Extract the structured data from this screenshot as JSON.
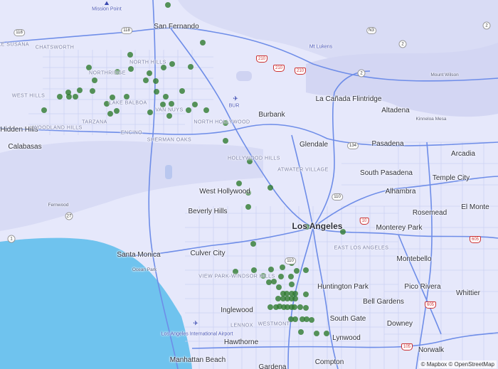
{
  "attribution": "© Mapbox © OpenStreetMap",
  "colors": {
    "land": "#e6e8fb",
    "water": "#6fc3ee",
    "park": "#d8dcf6",
    "road_major": "#6e8de8",
    "road_minor": "#c9cef2",
    "point": "#2f7a2f"
  },
  "labels": {
    "cities": [
      {
        "id": "mission-point",
        "text": "Mission Point",
        "cls": "poi"
      },
      {
        "id": "san-fernando",
        "text": "San Fernando",
        "cls": "city"
      },
      {
        "id": "mt-lukens",
        "text": "Mt Lukens",
        "cls": "poi"
      },
      {
        "id": "lake-susana",
        "text": "Lake Susana",
        "cls": "hood"
      },
      {
        "id": "chatsworth",
        "text": "CHATSWORTH",
        "cls": "hood"
      },
      {
        "id": "northridge",
        "text": "NORTHRIDGE",
        "cls": "hood"
      },
      {
        "id": "west-hills",
        "text": "WEST HILLS",
        "cls": "hood"
      },
      {
        "id": "lake-balboa",
        "text": "LAKE BALBOA",
        "cls": "hood"
      },
      {
        "id": "van-nuys",
        "text": "VAN NUYS",
        "cls": "hood"
      },
      {
        "id": "north-hills",
        "text": "NORTH HILLS",
        "cls": "hood"
      },
      {
        "id": "north-hollywood",
        "text": "NORTH HOLLYWOOD",
        "cls": "hood"
      },
      {
        "id": "bur",
        "text": "BUR",
        "cls": "poi"
      },
      {
        "id": "burbank",
        "text": "Burbank",
        "cls": "city"
      },
      {
        "id": "la-canada",
        "text": "La Cañada Flintridge",
        "cls": "city"
      },
      {
        "id": "altadena",
        "text": "Altadena",
        "cls": "city"
      },
      {
        "id": "kinneloa-mesa",
        "text": "Kinneloa Mesa",
        "cls": "peak"
      },
      {
        "id": "mount-wilson",
        "text": "Mount Wilson",
        "cls": "peak"
      },
      {
        "id": "hidden-hills",
        "text": "Hidden Hills",
        "cls": "city"
      },
      {
        "id": "woodland-hills",
        "text": "WOODLAND HILLS",
        "cls": "hood"
      },
      {
        "id": "tarzana",
        "text": "TARZANA",
        "cls": "hood"
      },
      {
        "id": "encino",
        "text": "ENCINO",
        "cls": "hood"
      },
      {
        "id": "sherman-oaks",
        "text": "SHERMAN OAKS",
        "cls": "hood"
      },
      {
        "id": "calabasas",
        "text": "Calabasas",
        "cls": "city"
      },
      {
        "id": "glendale",
        "text": "Glendale",
        "cls": "city"
      },
      {
        "id": "pasadena",
        "text": "Pasadena",
        "cls": "city"
      },
      {
        "id": "arcadia",
        "text": "Arcadia",
        "cls": "city"
      },
      {
        "id": "hollywood-hills",
        "text": "HOLLYWOOD HILLS",
        "cls": "hood"
      },
      {
        "id": "atwater-village",
        "text": "ATWATER VILLAGE",
        "cls": "hood"
      },
      {
        "id": "south-pasadena",
        "text": "South Pasadena",
        "cls": "city"
      },
      {
        "id": "temple-city",
        "text": "Temple City",
        "cls": "city"
      },
      {
        "id": "west-hollywood",
        "text": "West Hollywood",
        "cls": "city"
      },
      {
        "id": "alhambra",
        "text": "Alhambra",
        "cls": "city"
      },
      {
        "id": "fernwood",
        "text": "Fernwood",
        "cls": "peak"
      },
      {
        "id": "beverly-hills",
        "text": "Beverly Hills",
        "cls": "city"
      },
      {
        "id": "rosemead",
        "text": "Rosemead",
        "cls": "city"
      },
      {
        "id": "el-monte",
        "text": "El Monte",
        "cls": "city"
      },
      {
        "id": "los-angeles",
        "text": "Los Angeles",
        "cls": "big"
      },
      {
        "id": "monterey-park",
        "text": "Monterey Park",
        "cls": "city"
      },
      {
        "id": "east-los-angeles",
        "text": "EAST LOS ANGELES",
        "cls": "hood"
      },
      {
        "id": "santa-monica",
        "text": "Santa Monica",
        "cls": "city"
      },
      {
        "id": "culver-city",
        "text": "Culver City",
        "cls": "city"
      },
      {
        "id": "montebello",
        "text": "Montebello",
        "cls": "city"
      },
      {
        "id": "ocean-park",
        "text": "Ocean Park",
        "cls": "peak"
      },
      {
        "id": "view-park",
        "text": "VIEW PARK-WINDSOR HILLS",
        "cls": "hood"
      },
      {
        "id": "huntington-park",
        "text": "Huntington Park",
        "cls": "city"
      },
      {
        "id": "pico-rivera",
        "text": "Pico Rivera",
        "cls": "city"
      },
      {
        "id": "whittier",
        "text": "Whittier",
        "cls": "city"
      },
      {
        "id": "bell-gardens",
        "text": "Bell Gardens",
        "cls": "city"
      },
      {
        "id": "inglewood",
        "text": "Inglewood",
        "cls": "city"
      },
      {
        "id": "south-gate",
        "text": "South Gate",
        "cls": "city"
      },
      {
        "id": "downey",
        "text": "Downey",
        "cls": "city"
      },
      {
        "id": "lax",
        "text": "Los Angeles International Airport",
        "cls": "poi"
      },
      {
        "id": "lennox",
        "text": "LENNOX",
        "cls": "hood"
      },
      {
        "id": "westmont",
        "text": "WESTMONT",
        "cls": "hood"
      },
      {
        "id": "lynwood",
        "text": "Lynwood",
        "cls": "city"
      },
      {
        "id": "hawthorne",
        "text": "Hawthorne",
        "cls": "city"
      },
      {
        "id": "norwalk",
        "text": "Norwalk",
        "cls": "city"
      },
      {
        "id": "manhattan-beach",
        "text": "Manhattan Beach",
        "cls": "city"
      },
      {
        "id": "compton",
        "text": "Compton",
        "cls": "city"
      },
      {
        "id": "gardena",
        "text": "Gardena",
        "cls": "city"
      }
    ],
    "shields": [
      {
        "id": "s118a",
        "text": "118",
        "type": "ca"
      },
      {
        "id": "s118b",
        "text": "118",
        "type": "ca"
      },
      {
        "id": "sn3",
        "text": "N3",
        "type": "ca"
      },
      {
        "id": "s2a",
        "text": "2",
        "type": "circ"
      },
      {
        "id": "s2b",
        "text": "2",
        "type": "circ"
      },
      {
        "id": "s2c",
        "text": "2",
        "type": "circ"
      },
      {
        "id": "s210a",
        "text": "210",
        "type": "interstate"
      },
      {
        "id": "s210b",
        "text": "210",
        "type": "interstate"
      },
      {
        "id": "s210c",
        "text": "210",
        "type": "interstate"
      },
      {
        "id": "s134",
        "text": "134",
        "type": "ca"
      },
      {
        "id": "s110a",
        "text": "110",
        "type": "ca"
      },
      {
        "id": "s110b",
        "text": "110",
        "type": "ca"
      },
      {
        "id": "s27",
        "text": "27",
        "type": "circ"
      },
      {
        "id": "s1",
        "text": "1",
        "type": "circ"
      },
      {
        "id": "s10",
        "text": "10",
        "type": "interstate"
      },
      {
        "id": "s605a",
        "text": "605",
        "type": "interstate"
      },
      {
        "id": "s605b",
        "text": "605",
        "type": "interstate"
      },
      {
        "id": "s105",
        "text": "105",
        "type": "interstate"
      }
    ]
  },
  "data_points": [
    [
      236,
      7
    ],
    [
      285,
      60
    ],
    [
      183,
      77
    ],
    [
      125,
      95
    ],
    [
      184,
      97
    ],
    [
      242,
      90
    ],
    [
      268,
      94
    ],
    [
      230,
      95
    ],
    [
      165,
      101
    ],
    [
      210,
      103
    ],
    [
      205,
      113
    ],
    [
      133,
      113
    ],
    [
      219,
      114
    ],
    [
      112,
      127
    ],
    [
      84,
      136
    ],
    [
      96,
      130
    ],
    [
      106,
      136
    ],
    [
      97,
      136
    ],
    [
      130,
      128
    ],
    [
      220,
      129
    ],
    [
      158,
      137
    ],
    [
      178,
      136
    ],
    [
      233,
      136
    ],
    [
      256,
      128
    ],
    [
      241,
      146
    ],
    [
      229,
      147
    ],
    [
      274,
      147
    ],
    [
      290,
      155
    ],
    [
      150,
      146
    ],
    [
      164,
      156
    ],
    [
      155,
      160
    ],
    [
      265,
      155
    ],
    [
      211,
      158
    ],
    [
      238,
      163
    ],
    [
      62,
      155
    ],
    [
      317,
      173
    ],
    [
      317,
      198
    ],
    [
      351,
      227
    ],
    [
      336,
      258
    ],
    [
      349,
      271
    ],
    [
      380,
      264
    ],
    [
      349,
      291
    ],
    [
      482,
      326
    ],
    [
      431,
      319
    ],
    [
      356,
      343
    ],
    [
      410,
      370
    ],
    [
      331,
      382
    ],
    [
      381,
      379
    ],
    [
      357,
      380
    ],
    [
      397,
      376
    ],
    [
      417,
      381
    ],
    [
      370,
      388
    ],
    [
      395,
      389
    ],
    [
      409,
      389
    ],
    [
      430,
      380
    ],
    [
      378,
      397
    ],
    [
      385,
      396
    ],
    [
      410,
      400
    ],
    [
      392,
      404
    ],
    [
      398,
      413
    ],
    [
      403,
      413
    ],
    [
      410,
      413
    ],
    [
      415,
      413
    ],
    [
      430,
      414
    ],
    [
      391,
      420
    ],
    [
      398,
      420
    ],
    [
      404,
      420
    ],
    [
      410,
      420
    ],
    [
      415,
      420
    ],
    [
      380,
      432
    ],
    [
      388,
      432
    ],
    [
      393,
      431
    ],
    [
      399,
      432
    ],
    [
      404,
      432
    ],
    [
      410,
      432
    ],
    [
      414,
      432
    ],
    [
      422,
      432
    ],
    [
      430,
      433
    ],
    [
      409,
      449
    ],
    [
      415,
      449
    ],
    [
      425,
      449
    ],
    [
      431,
      449
    ],
    [
      438,
      450
    ],
    [
      445,
      469
    ],
    [
      459,
      469
    ],
    [
      423,
      467
    ]
  ]
}
